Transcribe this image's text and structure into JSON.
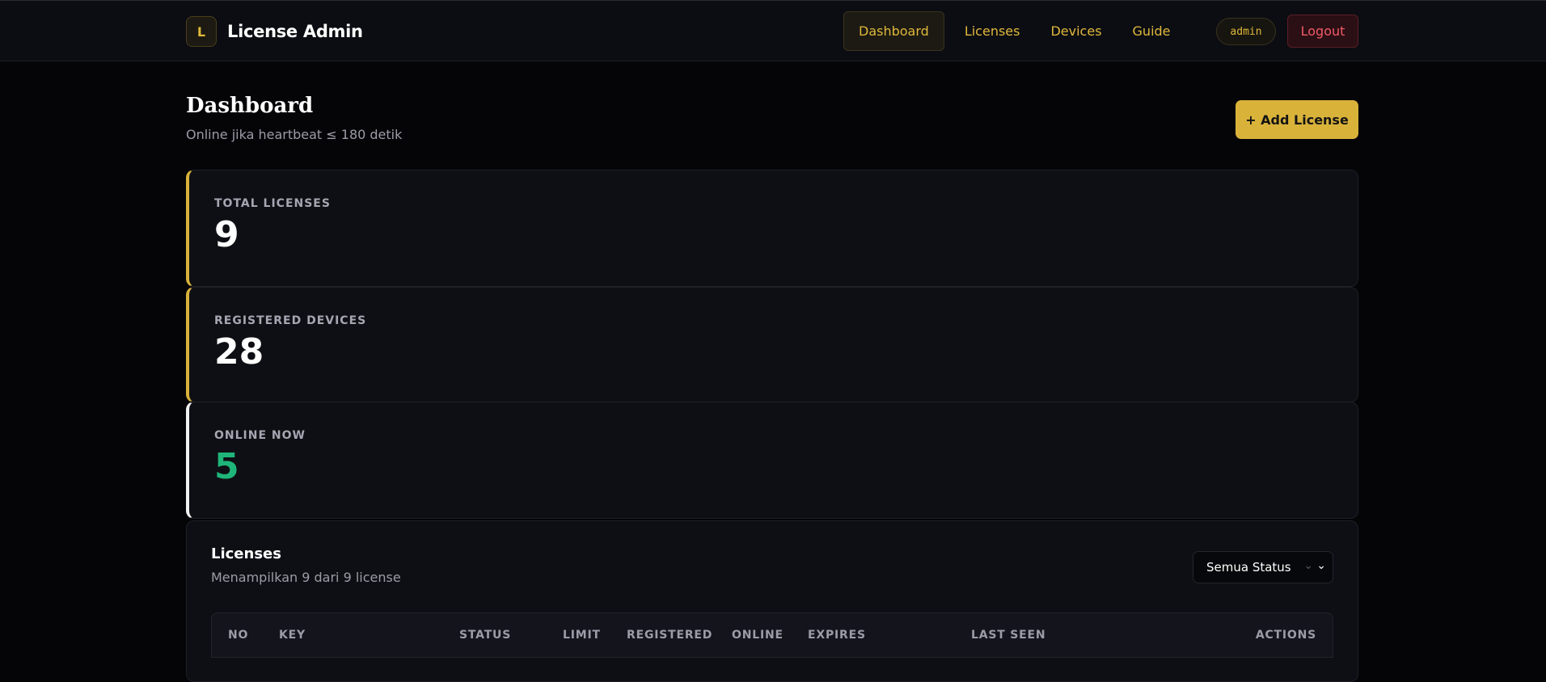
{
  "app": {
    "logo_letter": "L",
    "name": "License Admin"
  },
  "nav": {
    "items": [
      {
        "label": "Dashboard",
        "active": true
      },
      {
        "label": "Licenses",
        "active": false
      },
      {
        "label": "Devices",
        "active": false
      },
      {
        "label": "Guide",
        "active": false
      }
    ],
    "user": "admin",
    "logout_label": "Logout"
  },
  "header": {
    "title": "Dashboard",
    "subtitle": "Online jika heartbeat ≤ 180 detik",
    "add_button_label": "+ Add License"
  },
  "stats": [
    {
      "label": "TOTAL LICENSES",
      "value": "9"
    },
    {
      "label": "REGISTERED DEVICES",
      "value": "28"
    },
    {
      "label": "ONLINE NOW",
      "value": "5"
    }
  ],
  "licenses_panel": {
    "title": "Licenses",
    "subtitle": "Menampilkan 9 dari 9 license",
    "filter": {
      "selected": "Semua Status"
    },
    "columns": [
      "NO",
      "KEY",
      "STATUS",
      "LIMIT",
      "REGISTERED",
      "ONLINE",
      "EXPIRES",
      "LAST SEEN",
      "ACTIONS"
    ]
  },
  "colors": {
    "accent": "#d9b23a",
    "online": "#1fb57a",
    "danger": "#f05a66",
    "background": "#050508",
    "card": "#0e0f14"
  },
  "icons": {
    "filter_chevron": "chevron-down-icon"
  }
}
